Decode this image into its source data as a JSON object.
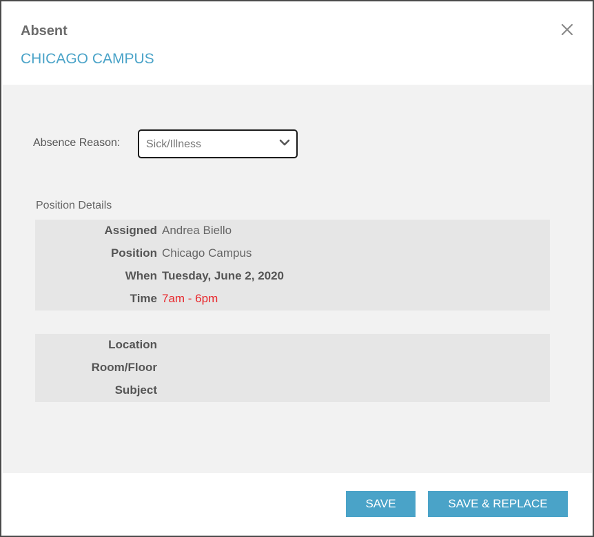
{
  "dialog": {
    "title": "Absent",
    "subtitle": "CHICAGO CAMPUS",
    "close_icon": "close-icon"
  },
  "form": {
    "reason_label": "Absence Reason:",
    "reason_value": "Sick/Illness"
  },
  "position_details": {
    "section_label": "Position Details",
    "rows": [
      {
        "label": "Assigned",
        "value": "Andrea Biello"
      },
      {
        "label": "Position",
        "value": "Chicago Campus"
      },
      {
        "label": "When",
        "value": "Tuesday, June 2, 2020"
      },
      {
        "label": "Time",
        "value": "7am - 6pm"
      }
    ]
  },
  "location_details": {
    "rows": [
      {
        "label": "Location",
        "value": ""
      },
      {
        "label": "Room/Floor",
        "value": ""
      },
      {
        "label": "Subject",
        "value": ""
      }
    ]
  },
  "footer": {
    "save_label": "SAVE",
    "save_replace_label": "SAVE & REPLACE"
  },
  "colors": {
    "accent": "#4aa3c8",
    "time_text": "#e8262b",
    "body_bg": "#f2f2f2",
    "panel_bg": "#e6e6e6"
  }
}
